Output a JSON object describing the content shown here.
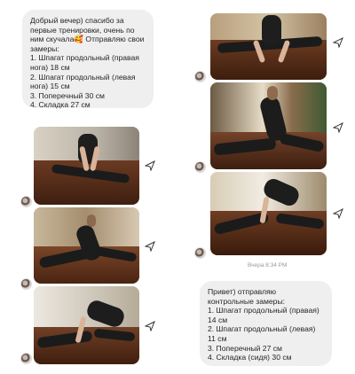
{
  "messages": {
    "first": {
      "lines": [
        "Добрый вечер) спасибо за",
        "первые тренировки, очень по",
        "ним скучала🥰 Отправляю свои",
        "замеры:",
        "1. Шпагат продольный (правая",
        "нога) 18 см",
        "2. Шпагат продольный (левая",
        "нога) 15 см",
        "3. Поперечный 30 см",
        "4. Складка 27 см"
      ]
    },
    "second": {
      "lines": [
        "Привет) отправляю",
        "контрольные замеры:",
        "1. Шпагат продольный (правая)",
        "14 см",
        "2. Шпагат продольный (левая)",
        "11 см",
        "3. Поперечный 27 см",
        "4. Складка (сидя) 30 см"
      ]
    }
  },
  "timestamp": "Вчера 8:34 PM",
  "icons": {
    "avatar": "avatar",
    "share": "share-arrow-icon"
  },
  "colors": {
    "bubble": "#efefef",
    "wood_floor": "#5a2e1a",
    "outfit": "#1b1b1b"
  }
}
